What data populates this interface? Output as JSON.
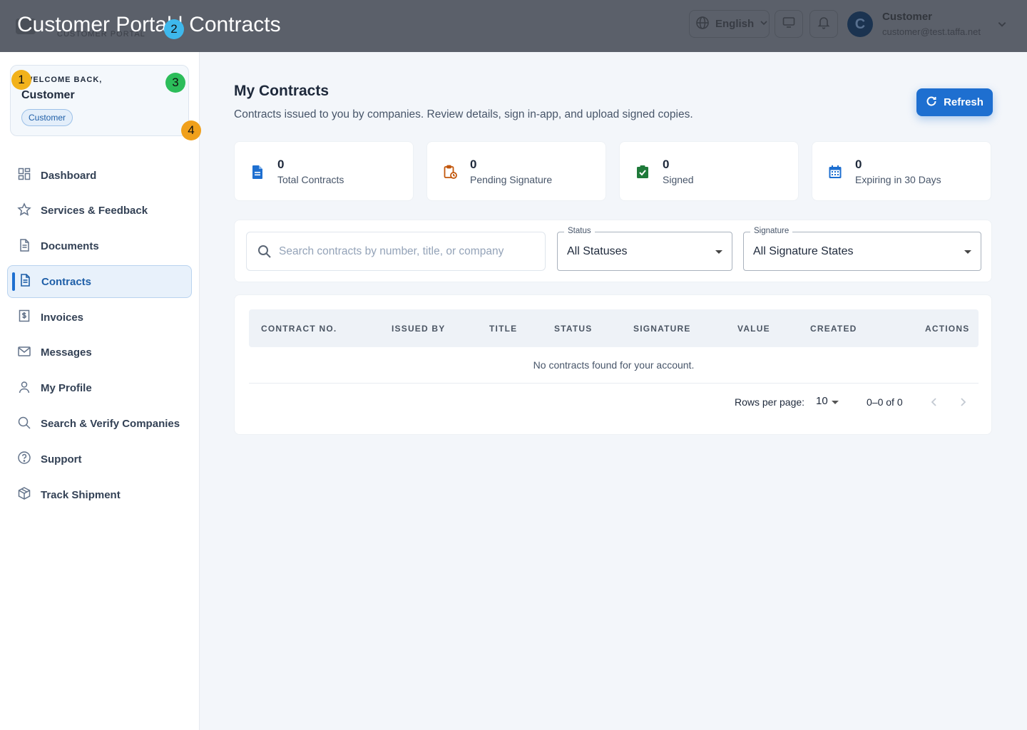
{
  "topbar": {
    "brand_sub": "CUSTOMER PORTAL",
    "overlay_title": "Customer Portal | Contracts",
    "language": "English",
    "user_name": "Customer",
    "user_email": "customer@test.taffa.net",
    "avatar_initial": "C"
  },
  "markers": [
    "1",
    "2",
    "3",
    "4"
  ],
  "sidebar": {
    "welcome_label": "WELCOME BACK,",
    "welcome_name": "Customer",
    "role": "Customer",
    "items": [
      {
        "label": "Dashboard",
        "icon": "dashboard-icon"
      },
      {
        "label": "Services & Feedback",
        "icon": "star-icon"
      },
      {
        "label": "Documents",
        "icon": "document-icon"
      },
      {
        "label": "Contracts",
        "icon": "contract-icon",
        "active": true
      },
      {
        "label": "Invoices",
        "icon": "invoice-icon"
      },
      {
        "label": "Messages",
        "icon": "mail-icon"
      },
      {
        "label": "My Profile",
        "icon": "person-icon"
      },
      {
        "label": "Search & Verify Companies",
        "icon": "search-icon"
      },
      {
        "label": "Support",
        "icon": "help-icon"
      },
      {
        "label": "Track Shipment",
        "icon": "package-icon"
      }
    ]
  },
  "main": {
    "title": "My Contracts",
    "subtitle": "Contracts issued to you by companies. Review details, sign in-app, and upload signed copies.",
    "refresh_label": "Refresh",
    "stats": [
      {
        "value": "0",
        "label": "Total Contracts",
        "color": "#1e6fd0"
      },
      {
        "value": "0",
        "label": "Pending Signature",
        "color": "#c2570c"
      },
      {
        "value": "0",
        "label": "Signed",
        "color": "#1f7a3a"
      },
      {
        "value": "0",
        "label": "Expiring in 30 Days",
        "color": "#1e6fd0"
      }
    ],
    "filters": {
      "search_placeholder": "Search contracts by number, title, or company",
      "status_legend": "Status",
      "status_value": "All Statuses",
      "signature_legend": "Signature",
      "signature_value": "All Signature States"
    },
    "table": {
      "columns": [
        "CONTRACT NO.",
        "ISSUED BY",
        "TITLE",
        "STATUS",
        "SIGNATURE",
        "VALUE",
        "CREATED",
        "ACTIONS"
      ],
      "empty_message": "No contracts found for your account.",
      "rows_per_page_label": "Rows per page:",
      "rows_per_page_value": "10",
      "range": "0–0 of 0"
    }
  },
  "colors": {
    "accent": "#1e6fd0",
    "topbar": "#5b606a"
  }
}
